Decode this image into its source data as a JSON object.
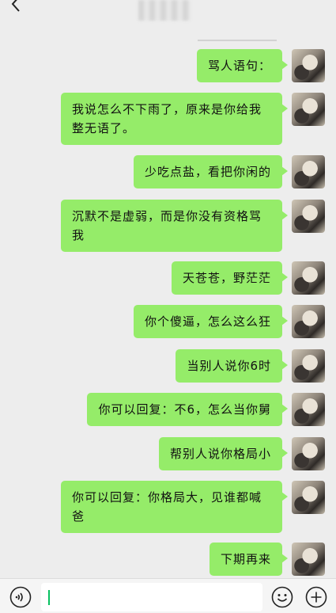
{
  "header": {
    "back_icon": "chevron-left-icon"
  },
  "messages": [
    {
      "text": "骂人语句："
    },
    {
      "text": "我说怎么不下雨了，原来是你给我整无语了。"
    },
    {
      "text": "少吃点盐，看把你闲的"
    },
    {
      "text": "沉默不是虚弱，而是你没有资格骂我"
    },
    {
      "text": "天苍苍，野茫茫"
    },
    {
      "text": "你个傻逼，怎么这么狂"
    },
    {
      "text": "当别人说你6时"
    },
    {
      "text": "你可以回复：不6，怎么当你舅"
    },
    {
      "text": "帮别人说你格局小"
    },
    {
      "text": "你可以回复：你格局大，见谁都喊爸"
    },
    {
      "text": "下期再来"
    }
  ],
  "input": {
    "value": ""
  },
  "icons": {
    "voice": "voice-icon",
    "emoji": "emoji-icon",
    "plus": "plus-icon"
  },
  "colors": {
    "bubble": "#95ec69",
    "background": "#ededed",
    "cursor": "#07c160"
  }
}
